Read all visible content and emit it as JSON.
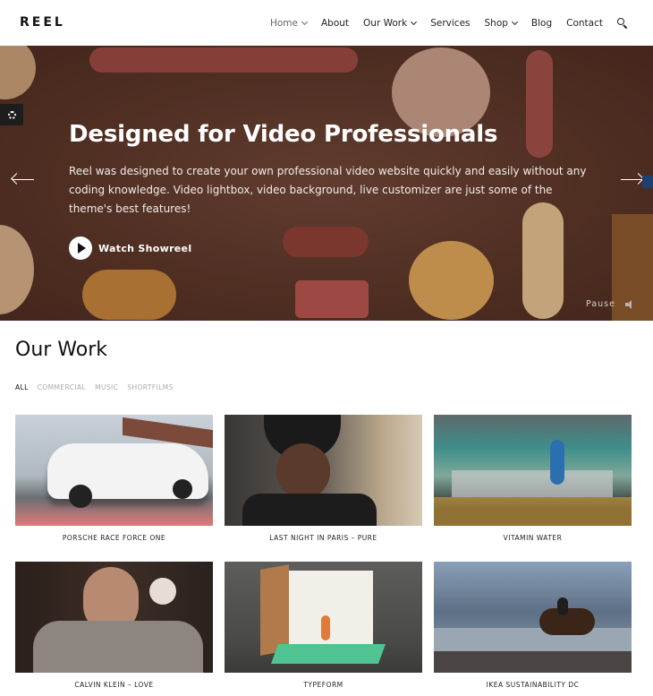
{
  "header": {
    "logo": "REEL",
    "nav": [
      {
        "label": "Home",
        "dropdown": true,
        "active": true
      },
      {
        "label": "About",
        "dropdown": false
      },
      {
        "label": "Our Work",
        "dropdown": true
      },
      {
        "label": "Services",
        "dropdown": false
      },
      {
        "label": "Shop",
        "dropdown": true
      },
      {
        "label": "Blog",
        "dropdown": false
      },
      {
        "label": "Contact",
        "dropdown": false
      }
    ],
    "search_icon": "search-icon"
  },
  "hero": {
    "title": "Designed for Video Professionals",
    "text": "Reel was designed to create your own professional video website quickly and easily without any coding knowledge. Video lightbox, video background, live customizer are just some of the theme's best features!",
    "showreel_label": "Watch Showreel",
    "pause_label": "Pause",
    "icons": [
      "settings-gear-icon",
      "arrow-left-icon",
      "arrow-right-icon",
      "play-icon",
      "volume-icon"
    ]
  },
  "work": {
    "title": "Our Work",
    "filters": [
      {
        "label": "ALL",
        "active": true
      },
      {
        "label": "COMMERCIAL",
        "active": false
      },
      {
        "label": "MUSIC",
        "active": false
      },
      {
        "label": "SHORTFILMS",
        "active": false
      }
    ],
    "items": [
      {
        "caption": "PORSCHE RACE FORCE ONE"
      },
      {
        "caption": "LAST NIGHT IN PARIS – PURE"
      },
      {
        "caption": "VITAMIN WATER"
      },
      {
        "caption": "CALVIN KLEIN – LOVE"
      },
      {
        "caption": "TYPEFORM"
      },
      {
        "caption": "IKEA SUSTAINABILITY DC"
      }
    ]
  },
  "colors": {
    "hero_bg": "#5a3629",
    "text": "#222222",
    "filter_inactive": "#aaaaaa"
  }
}
